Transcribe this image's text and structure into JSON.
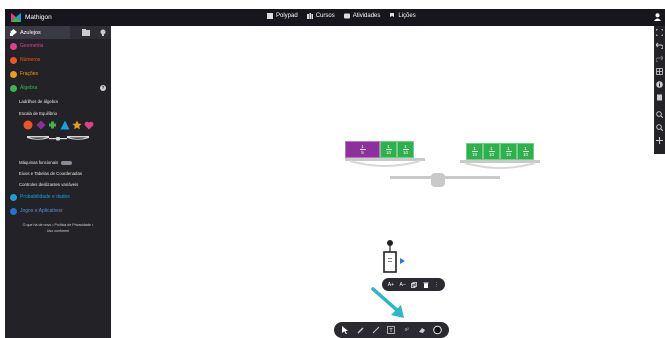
{
  "app": {
    "title": "Mathigon"
  },
  "nav": {
    "items": [
      {
        "label": "Polypad",
        "icon": "polypad-icon"
      },
      {
        "label": "Cursos",
        "icon": "courses-icon"
      },
      {
        "label": "Atividades",
        "icon": "activities-icon"
      },
      {
        "label": "Lições",
        "icon": "lessons-icon"
      }
    ]
  },
  "sidebar": {
    "tab_label": "Azulejos",
    "categories": [
      {
        "label": "Geometria",
        "color": "#e0408a"
      },
      {
        "label": "Números",
        "color": "#ee5523"
      },
      {
        "label": "Frações",
        "color": "#ee9b1c"
      },
      {
        "label": "Álgebra",
        "color": "#3bb54a"
      },
      {
        "label": "Probabilidade e dados",
        "color": "#1c9fd8"
      },
      {
        "label": "Jogos e Aplicativos",
        "color": "#1c73d8"
      }
    ],
    "algebra_items": {
      "item1": "Ladrilhos de álgebra",
      "item2": "Escala de Equilíbrio",
      "item3": "Máquinas funcionais",
      "item4": "Eixos e Tabelas de Coordenadas",
      "item5": "Controles deslizantes variáveis"
    },
    "legal_line1": "O que há de novo  •  Política de Privacidade  •",
    "legal_line2": "Uso conforme",
    "help_label": "?"
  },
  "scale": {
    "left": {
      "purple": {
        "num": "1",
        "den": "5"
      },
      "tiles": [
        {
          "num": "1",
          "den": "10"
        },
        {
          "num": "1",
          "den": "10"
        }
      ]
    },
    "right": {
      "tiles": [
        {
          "num": "1",
          "den": "10"
        },
        {
          "num": "1",
          "den": "10"
        },
        {
          "num": "1",
          "den": "10"
        },
        {
          "num": "1",
          "den": "10"
        }
      ]
    },
    "colors": {
      "purple": "#8e2f9e",
      "green": "#2db14b",
      "beam": "#c9c9c9"
    }
  },
  "text_toolbar": {
    "increase": "A+",
    "decrease": "A–",
    "more": "⋮"
  },
  "draw_toolbar": {
    "superscript": "x²"
  },
  "accent": "#2bb6c9"
}
